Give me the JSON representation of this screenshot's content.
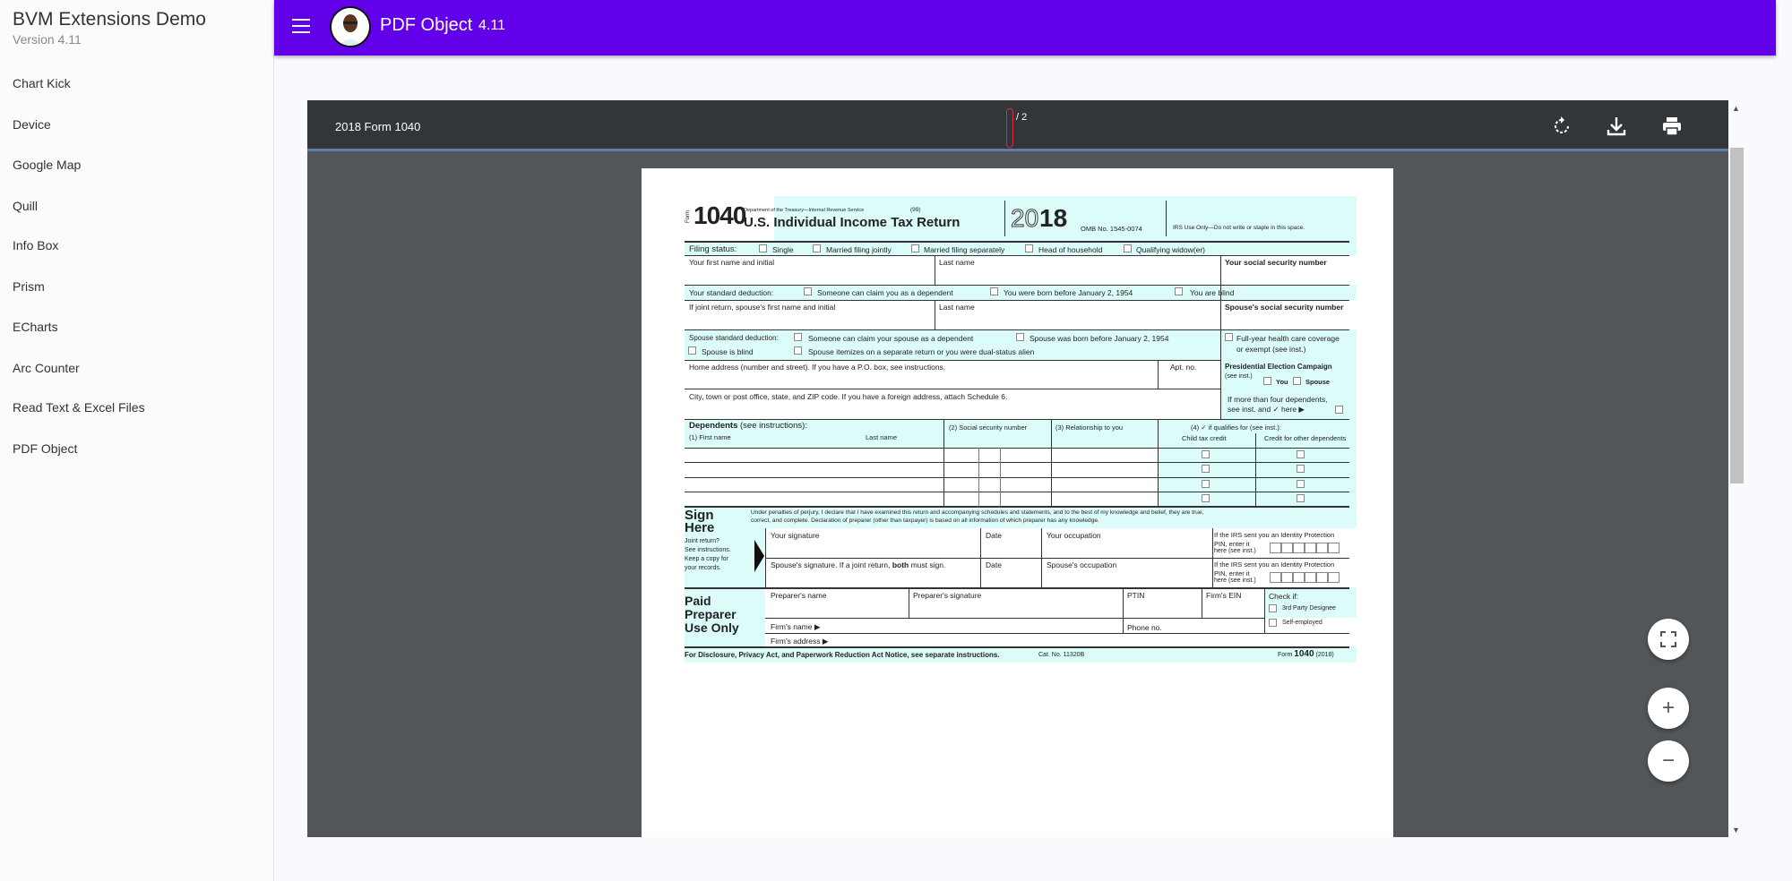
{
  "sidebar": {
    "title": "BVM Extensions Demo",
    "version": "Version 4.11",
    "items": [
      {
        "label": "Chart Kick"
      },
      {
        "label": "Device"
      },
      {
        "label": "Google Map"
      },
      {
        "label": "Quill"
      },
      {
        "label": "Info Box"
      },
      {
        "label": "Prism"
      },
      {
        "label": "ECharts"
      },
      {
        "label": "Arc Counter"
      },
      {
        "label": "Read Text & Excel Files"
      },
      {
        "label": "PDF Object"
      }
    ]
  },
  "header": {
    "title": "PDF Object",
    "version": "4.11",
    "menu_icon": "menu-icon",
    "avatar": "avatar"
  },
  "viewer": {
    "doc_title": "2018 Form 1040",
    "page_current": "",
    "page_total": "/ 2",
    "icons": [
      "rotate-icon",
      "download-icon",
      "print-icon"
    ],
    "fab_icons": [
      "fullscreen-icon",
      "zoom-in-icon",
      "zoom-out-icon"
    ],
    "zoom_in": "+",
    "zoom_out": "−"
  },
  "colors": {
    "appbar": "#6200ea",
    "toolbar": "#323639",
    "viewer_bg": "#525659",
    "form_tint": "#dcfcfa"
  },
  "form": {
    "form_word": "Form",
    "number": "1040",
    "dept": "Department of the Treasury—Internal Revenue Service",
    "code": "(99)",
    "title": "U.S. Individual Income Tax Return",
    "year_a": "20",
    "year_b": "18",
    "omb": "OMB No. 1545-0074",
    "irs_use": "IRS Use Only—Do not write or staple in this space.",
    "filing_label": "Filing status:",
    "filing": [
      "Single",
      "Married filing jointly",
      "Married filing separately",
      "Head of household",
      "Qualifying widow(er)"
    ],
    "first_name": "Your first name and initial",
    "last_name": "Last name",
    "ssn": "Your social security number",
    "std_label": "Your standard deduction:",
    "std": [
      "Someone can claim you as a dependent",
      "You were born before January 2, 1954",
      "You are blind"
    ],
    "sp_first": "If joint return, spouse's first name and initial",
    "sp_last": "Last name",
    "sp_ssn": "Spouse's social security number",
    "sp_std_label": "Spouse standard deduction:",
    "sp_std": [
      "Someone can claim your spouse as a dependent",
      "Spouse was born before January 2, 1954",
      "Spouse is blind",
      "Spouse itemizes on a separate return or you were dual-status alien"
    ],
    "health1": "Full-year health care coverage",
    "health2": "or exempt (see inst.)",
    "home": "Home address (number and street). If you have a P.O. box, see instructions.",
    "apt": "Apt. no.",
    "pec": "Presidential Election Campaign",
    "pec_inst": "(see inst.)",
    "pec_you": "You",
    "pec_spouse": "Spouse",
    "city": "City, town or post office, state, and ZIP code. If you have a foreign address, attach Schedule 6.",
    "more1": "If more than four dependents,",
    "more2": "see inst. and ✓ here ▶",
    "dep_title": "Dependents",
    "dep_inst": "(see instructions):",
    "dep_first": "(1)  First name",
    "dep_last": "Last name",
    "dep_ssn": "(2)  Social security number",
    "dep_rel": "(3)  Relationship to you",
    "dep_q": "(4)  ✓ if qualifies for (see inst.):",
    "dep_child": "Child tax credit",
    "dep_other": "Credit for other dependents",
    "sign1": "Sign",
    "sign2": "Here",
    "joint": [
      "Joint return?",
      "See instructions.",
      "Keep a copy for",
      "your records."
    ],
    "perjury1": "Under penalties of perjury, I declare that I have examined this return and accompanying schedules and statements, and to the best of my knowledge and belief, they are true,",
    "perjury2": "correct, and complete. Declaration of preparer (other than taxpayer) is based on all information of which preparer has any knowledge.",
    "your_sig": "Your signature",
    "date": "Date",
    "your_occ": "Your occupation",
    "pin1": "If the IRS sent you an Identity Protection",
    "pin2": "PIN, enter it",
    "pin3": "here (see inst.)",
    "sp_sig_a": "Spouse's signature. If a joint return, ",
    "sp_sig_b": "both",
    "sp_sig_c": " must sign.",
    "sp_occ": "Spouse's occupation",
    "paid1": "Paid",
    "paid2": "Preparer",
    "paid3": "Use Only",
    "prep_name": "Preparer's name",
    "prep_sig": "Preparer's signature",
    "ptin": "PTIN",
    "ein": "Firm's EIN",
    "check_if": "Check if:",
    "third": "3rd Party Designee",
    "self": "Self-employed",
    "firm_name": "Firm's name  ▶",
    "phone": "Phone no.",
    "firm_addr": "Firm's address ▶",
    "footer": "For Disclosure, Privacy Act, and Paperwork Reduction Act Notice, see separate instructions.",
    "cat": "Cat. No. 11320B",
    "foot_form": "Form",
    "foot_num": "1040",
    "foot_year": "(2018)"
  }
}
